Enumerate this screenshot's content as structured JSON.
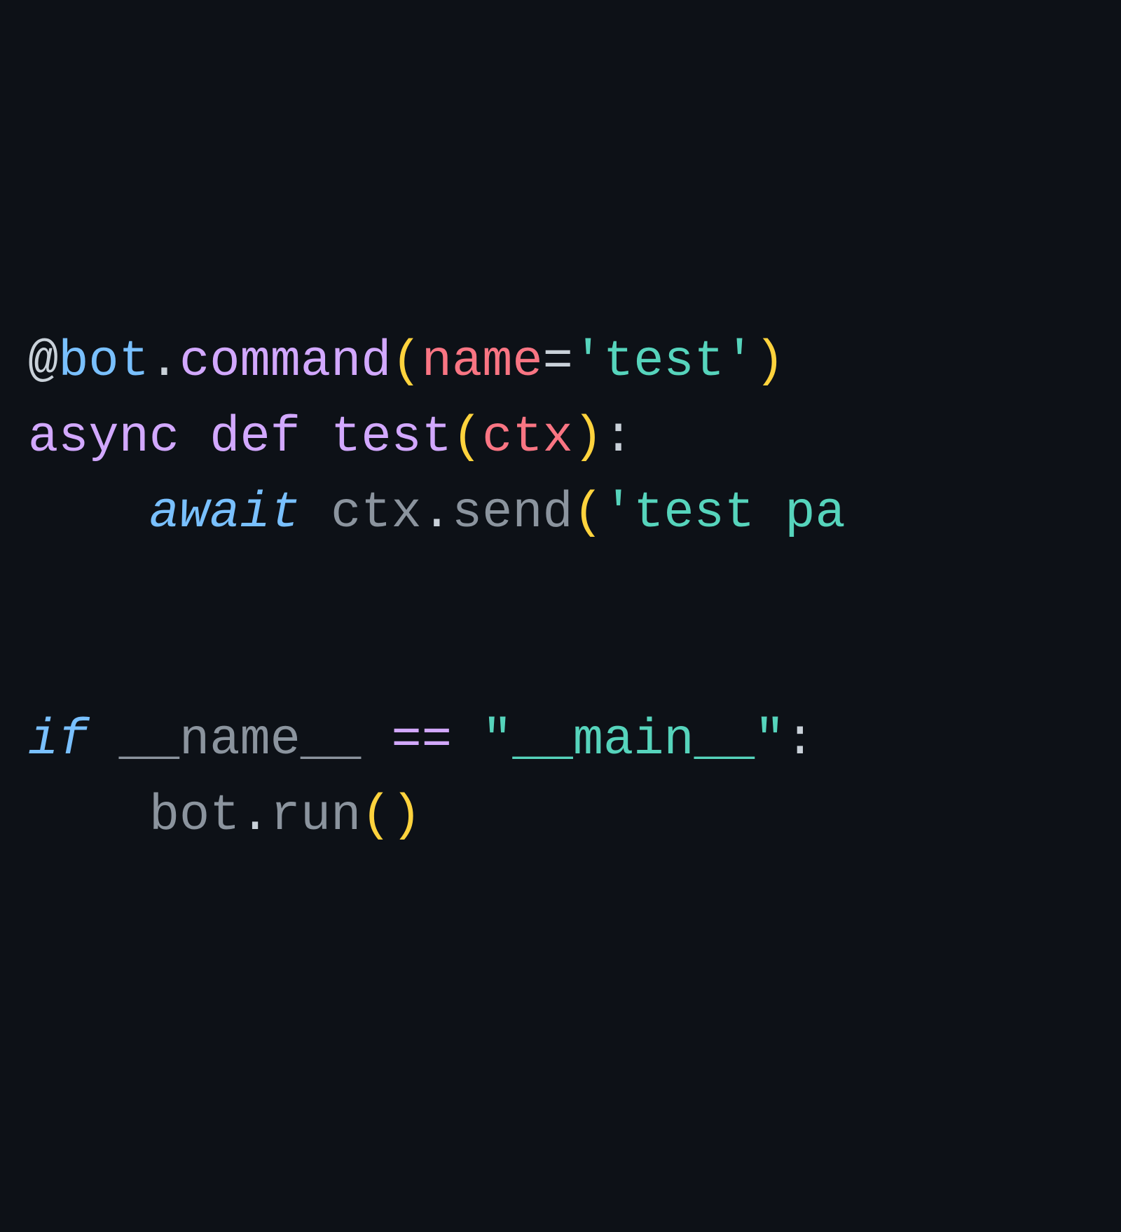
{
  "code": {
    "line1": {
      "at": "@",
      "bot": "bot",
      "dot1": ".",
      "command": "command",
      "lparen": "(",
      "name": "name",
      "eq": "=",
      "q1": "'",
      "test": "test",
      "q2": "'",
      "rparen": ")"
    },
    "line2": {
      "async": "async",
      "sp1": " ",
      "def": "def",
      "sp2": " ",
      "test": "test",
      "lparen": "(",
      "ctx": "ctx",
      "rparen": ")",
      "colon": ":"
    },
    "line3": {
      "indent": "    ",
      "await": "await",
      "sp1": " ",
      "ctx": "ctx",
      "dot": ".",
      "send": "send",
      "lparen": "(",
      "q1": "'",
      "text": "test pa"
    },
    "line4": {
      "if": "if",
      "sp1": " ",
      "name": "__name__",
      "sp2": " ",
      "eqeq": "==",
      "sp3": " ",
      "q1": "\"",
      "main": "__main__",
      "q2": "\"",
      "colon": ":"
    },
    "line5": {
      "indent": "    ",
      "bot": "bot",
      "dot": ".",
      "run": "run",
      "lparen": "(",
      "rparen": ")"
    }
  }
}
